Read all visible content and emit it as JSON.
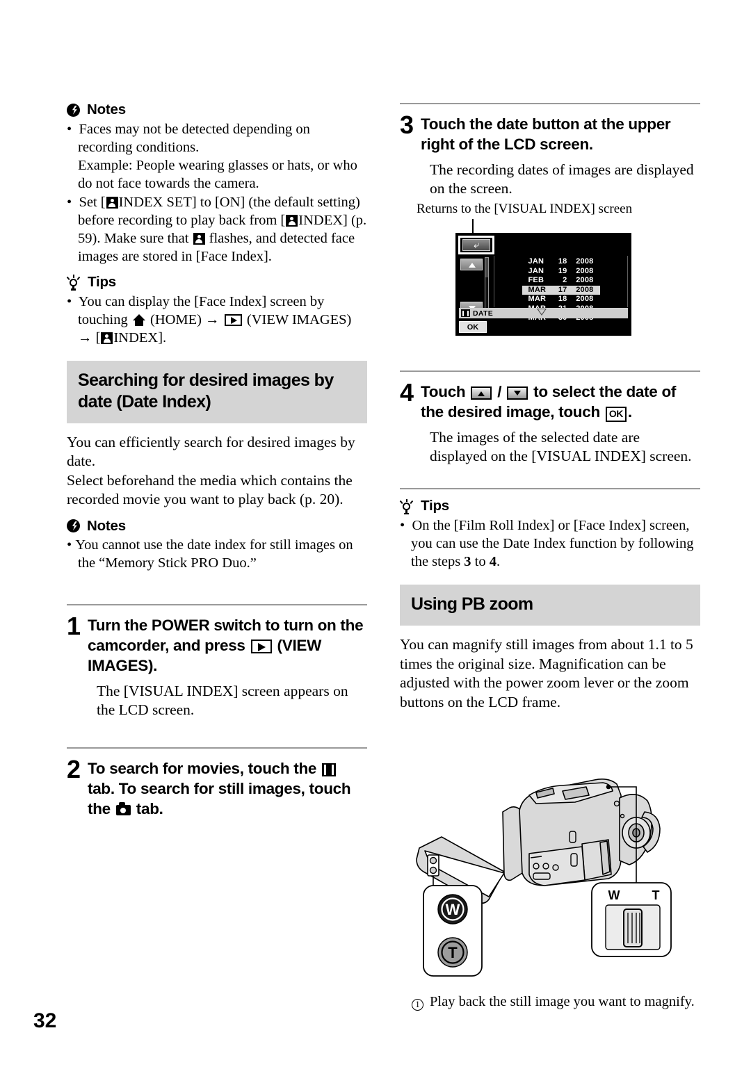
{
  "page": {
    "number": "32"
  },
  "left_column": {
    "notes1": {
      "heading": "Notes",
      "icon": "note-burst-icon",
      "items": [
        {
          "line1": "Faces may not be detected depending on recording conditions.",
          "line2": "Example: People wearing glasses or hats, or who do not face towards the camera."
        },
        {
          "part1": "Set [",
          "icon1": "face-index-icon",
          "part2": "INDEX SET] to [ON] (the default setting) before recording to play back from [",
          "icon2": "face-index-icon",
          "part3": "INDEX] (p. 59). Make sure that ",
          "icon3": "face-index-icon",
          "part4": " flashes, and detected face images are stored in [Face Index]."
        }
      ]
    },
    "tips1": {
      "heading": "Tips",
      "icon": "lightbulb-icon",
      "item": {
        "part1": "You can display the [Face Index] screen by touching ",
        "icon_home": "home-icon",
        "part2": " (HOME) → ",
        "icon_view": "view-images-icon",
        "part3": " (VIEW IMAGES) → [",
        "icon_face": "face-index-icon",
        "part4": "INDEX]."
      }
    },
    "banner": "Searching for desired images by date (Date Index)",
    "intro": {
      "p1": "You can efficiently search for desired images by date.",
      "p2": "Select beforehand the media which contains the recorded movie you want to play back (p. 20)."
    },
    "notes2": {
      "heading": "Notes",
      "icon": "note-burst-icon",
      "item": "You cannot use the date index for still images on the “Memory Stick PRO Duo.”"
    },
    "step1": {
      "number": "1",
      "head_part1": "Turn the POWER switch to turn on the camcorder, and press ",
      "head_icon": "view-images-icon",
      "head_part2": " (VIEW IMAGES).",
      "body": "The [VISUAL INDEX] screen appears on the LCD screen."
    },
    "step2": {
      "number": "2",
      "head_part1": "To search for movies, touch the ",
      "head_icon1": "film-strip-icon",
      "head_part2": " tab. To search for still images, touch the ",
      "head_icon2": "still-camera-icon",
      "head_part3": " tab."
    }
  },
  "right_column": {
    "step3": {
      "number": "3",
      "head": "Touch the date button at the upper right of the LCD screen.",
      "body": "The recording dates of images are displayed on the screen.",
      "figure_caption": "Returns to the [VISUAL INDEX] screen"
    },
    "lcd_screen": {
      "return_button": "return-arrow-icon",
      "up_button": "scroll-up-icon",
      "down_button": "scroll-down-icon",
      "dates": [
        {
          "month": "JAN",
          "day": "18",
          "year": "2008",
          "selected": false
        },
        {
          "month": "JAN",
          "day": "19",
          "year": "2008",
          "selected": false
        },
        {
          "month": "FEB",
          "day": "2",
          "year": "2008",
          "selected": false
        },
        {
          "month": "MAR",
          "day": "17",
          "year": "2008",
          "selected": true
        },
        {
          "month": "MAR",
          "day": "18",
          "year": "2008",
          "selected": false
        },
        {
          "month": "MAR",
          "day": "21",
          "year": "2008",
          "selected": false
        },
        {
          "month": "MAR",
          "day": "30",
          "year": "2008",
          "selected": false
        }
      ],
      "date_tab_label": "DATE",
      "date_tab_icon": "film-strip-icon",
      "ok_label": "OK"
    },
    "step4": {
      "number": "4",
      "head_part1": "Touch ",
      "head_icon_up": "up-arrow-button-icon",
      "head_sep": " / ",
      "head_icon_down": "down-arrow-button-icon",
      "head_part2": " to select the date of the desired image, touch ",
      "head_icon_ok": "ok-button-icon",
      "head_part3": ".",
      "body": "The images of the selected date are displayed on the [VISUAL INDEX] screen."
    },
    "tips2": {
      "heading": "Tips",
      "icon": "lightbulb-icon",
      "item_part1": "On the [Film Roll Index] or [Face Index] screen, you can use the Date Index function by following the steps ",
      "item_bold1": "3",
      "item_mid": " to ",
      "item_bold2": "4",
      "item_end": "."
    },
    "banner2": "Using PB zoom",
    "pb_body": "You can magnify still images from about 1.1 to 5 times the original size. Magnification can be adjusted with the power zoom lever or the zoom buttons on the LCD frame.",
    "camcorder_figure": {
      "lcd_buttons": {
        "wide": "W",
        "tele": "T"
      },
      "zoom_lever": {
        "wide": "W",
        "tele": "T"
      }
    },
    "footer_caption": {
      "number": "①",
      "text": "Play back the still image you want to magnify."
    }
  }
}
